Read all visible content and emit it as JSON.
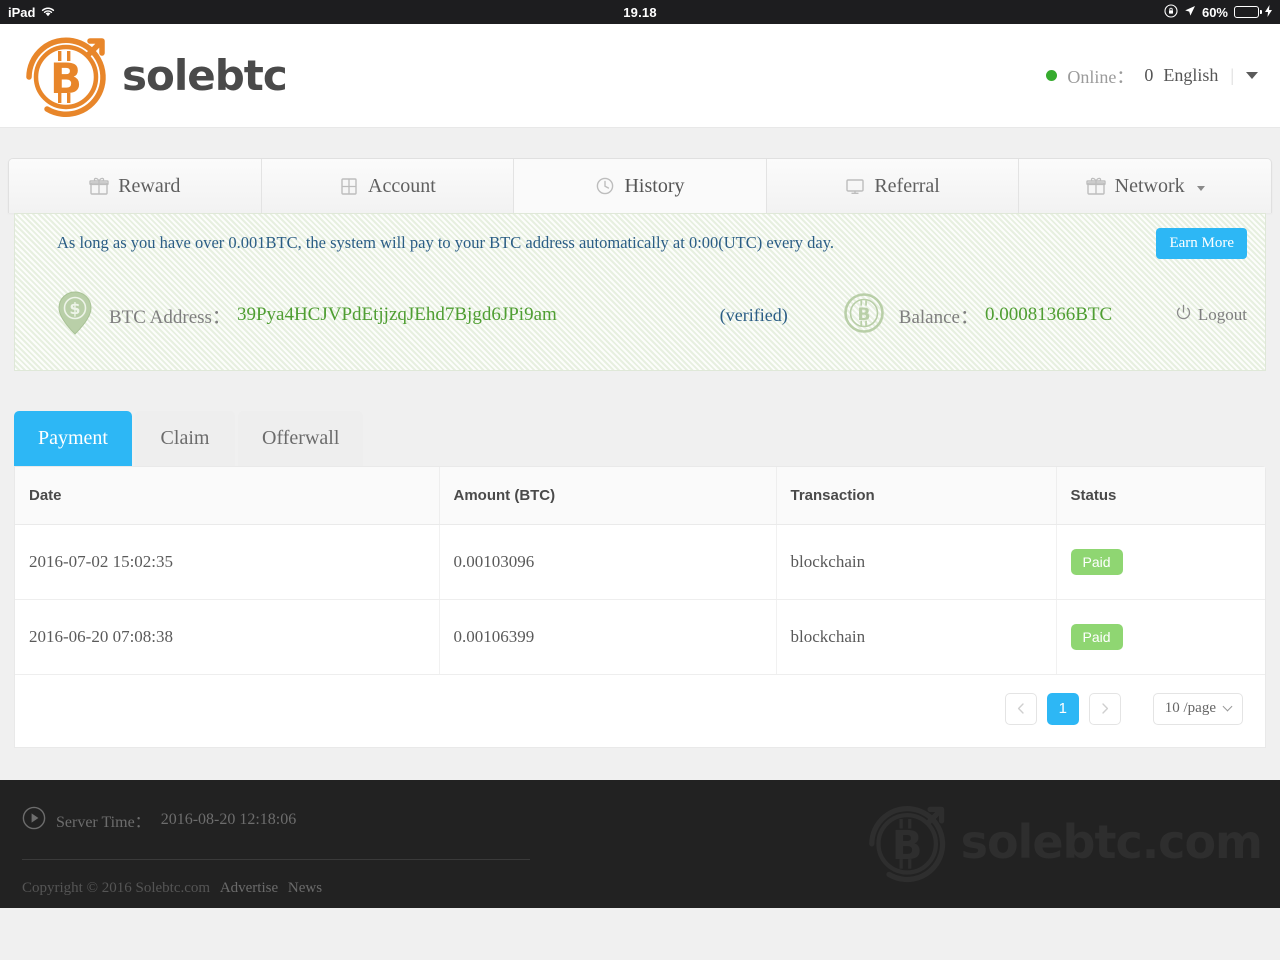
{
  "statusbar": {
    "device": "iPad",
    "wifi_icon": "wifi-icon",
    "time": "19.18",
    "rotation_lock_icon": "rotation-lock-icon",
    "location_icon": "location-arrow-icon",
    "battery_percent": "60%",
    "battery_level": 60,
    "charging_icon": "charging-bolt-icon"
  },
  "header": {
    "logo_icon": "bitcoin-logo-icon",
    "logo_text": "solebtc",
    "online_dot_color": "#36ab2e",
    "online_label": "Online：",
    "online_count": "0",
    "language": "English",
    "separator": "|",
    "caret_icon": "caret-down-icon"
  },
  "nav": {
    "tabs": [
      {
        "label": "Reward",
        "icon": "gift-icon",
        "active": false,
        "has_caret": false
      },
      {
        "label": "Account",
        "icon": "card-icon",
        "active": false,
        "has_caret": false
      },
      {
        "label": "History",
        "icon": "clock-icon",
        "active": true,
        "has_caret": false
      },
      {
        "label": "Referral",
        "icon": "monitor-icon",
        "active": false,
        "has_caret": false
      },
      {
        "label": "Network",
        "icon": "gift-icon",
        "active": false,
        "has_caret": true
      }
    ]
  },
  "panel": {
    "notice": "As long as you have over 0.001BTC, the system will pay to your BTC address automatically at 0:00(UTC) every day.",
    "earn_more_label": "Earn More",
    "earn_more_color": "#2db7f5",
    "address_icon": "map-pin-dollar-icon",
    "address_label": "BTC Address：",
    "address_value": "39Pya4HCJVPdEtjjzqJEhd7Bjgd6JPi9am",
    "verified_label": "(verified)",
    "balance_icon": "bitcoin-circle-icon",
    "balance_label": "Balance：",
    "balance_value": "0.00081366BTC",
    "logout_icon": "power-icon",
    "logout_label": "Logout"
  },
  "subtabs": [
    {
      "label": "Payment",
      "active": true
    },
    {
      "label": "Claim",
      "active": false
    },
    {
      "label": "Offerwall",
      "active": false
    }
  ],
  "table": {
    "columns": [
      "Date",
      "Amount (BTC)",
      "Transaction",
      "Status"
    ],
    "rows": [
      {
        "date": "2016-07-02 15:02:35",
        "amount": "0.00103096",
        "transaction": "blockchain",
        "status": "Paid"
      },
      {
        "date": "2016-06-20 07:08:38",
        "amount": "0.00106399",
        "transaction": "blockchain",
        "status": "Paid"
      }
    ],
    "status_color": "#8fd672"
  },
  "pagination": {
    "prev_icon": "chevron-left-icon",
    "page": "1",
    "next_icon": "chevron-right-icon",
    "page_size": "10 /page",
    "page_size_caret": "chevron-down-icon",
    "active_color": "#2db7f5"
  },
  "footer": {
    "play_icon": "play-circle-icon",
    "server_time_label": "Server Time：",
    "server_time_value": "2016-08-20 12:18:06",
    "copyright": "Copyright © 2016 Solebtc.com",
    "advertise_label": "Advertise",
    "news_label": "News",
    "watermark_icon": "bitcoin-logo-icon",
    "watermark_text": "solebtc.com"
  }
}
